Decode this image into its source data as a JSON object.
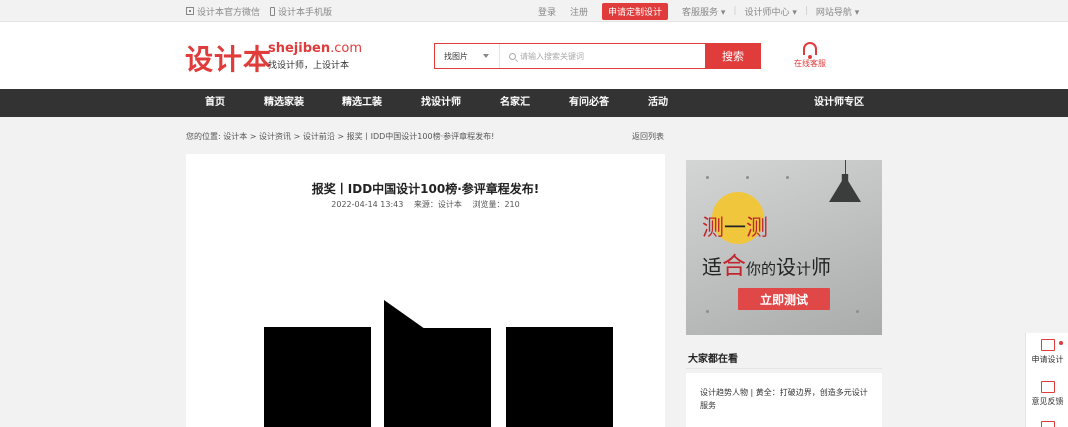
{
  "topbar": {
    "wechat": "设计本官方微信",
    "mobile": "设计本手机版",
    "login": "登录",
    "register": "注册",
    "apply": "申请定制设计",
    "service": "客服服务 ▾",
    "designer_center": "设计师中心 ▾",
    "site_nav": "网站导航 ▾"
  },
  "header": {
    "logo_cn": "设计本",
    "logo_en": "shejiben",
    "logo_en_suffix": ".com",
    "logo_sub": "找设计师，上设计本",
    "search_category": "找图片",
    "search_placeholder": "请输入搜索关键词",
    "search_button": "搜索",
    "online_service": "在线客服"
  },
  "nav": {
    "items": [
      "首页",
      "精选家装",
      "精选工装",
      "找设计师",
      "名家汇",
      "有问必答",
      "活动"
    ],
    "designer_zone": "设计师专区"
  },
  "breadcrumb": {
    "prefix": "您的位置:",
    "path": "设计本 > 设计资讯 > 设计前沿 > 报奖丨IDD中国设计100榜·参评章程发布!",
    "back": "返回列表"
  },
  "article": {
    "title": "报奖丨IDD中国设计100榜·参评章程发布!",
    "date": "2022-04-14 13:43",
    "source": "来源：设计本",
    "views": "浏览量：210"
  },
  "ad": {
    "line1_a": "测",
    "line1_b": "一",
    "line1_c": "测",
    "line2_a": "适",
    "line2_b": "合",
    "line2_c": "你的",
    "line2_d": "设",
    "line2_e": "计",
    "line2_f": "师",
    "button": "立即测试",
    "accent_color": "#e04848"
  },
  "sidebar": {
    "section_title": "大家都在看",
    "hot_item": "设计趋势人物 | 黄全：打破边界，创造多元设计服务"
  },
  "float_bar": {
    "apply": "申请设计",
    "feedback": "意见反馈"
  },
  "colors": {
    "brand_red": "#e03c3c",
    "nav_bg": "#333333"
  }
}
